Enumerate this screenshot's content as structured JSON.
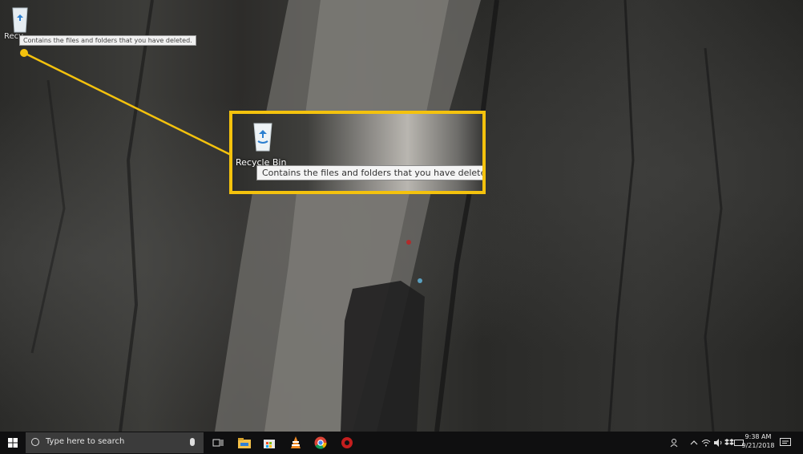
{
  "desktop": {
    "recycle_bin_label": "Recy",
    "tooltip_small": "Contains the files and folders that you have deleted."
  },
  "callout": {
    "recycle_bin_label": "Recycle Bin",
    "tooltip": "Contains the files and folders that you have deleted.",
    "highlight_color": "#f4c20d"
  },
  "taskbar": {
    "search_placeholder": "Type here to search",
    "clock_time": "9:38 AM",
    "clock_date": "9/21/2018",
    "pinned_icons": [
      "task-view-icon",
      "file-explorer-icon",
      "store-icon",
      "vlc-icon",
      "chrome-icon",
      "red-app-icon"
    ],
    "tray_icons": [
      "people-icon",
      "chevron-up-icon",
      "network-icon",
      "volume-icon",
      "dropbox-icon",
      "keyboard-icon",
      "action-center-icon"
    ]
  }
}
